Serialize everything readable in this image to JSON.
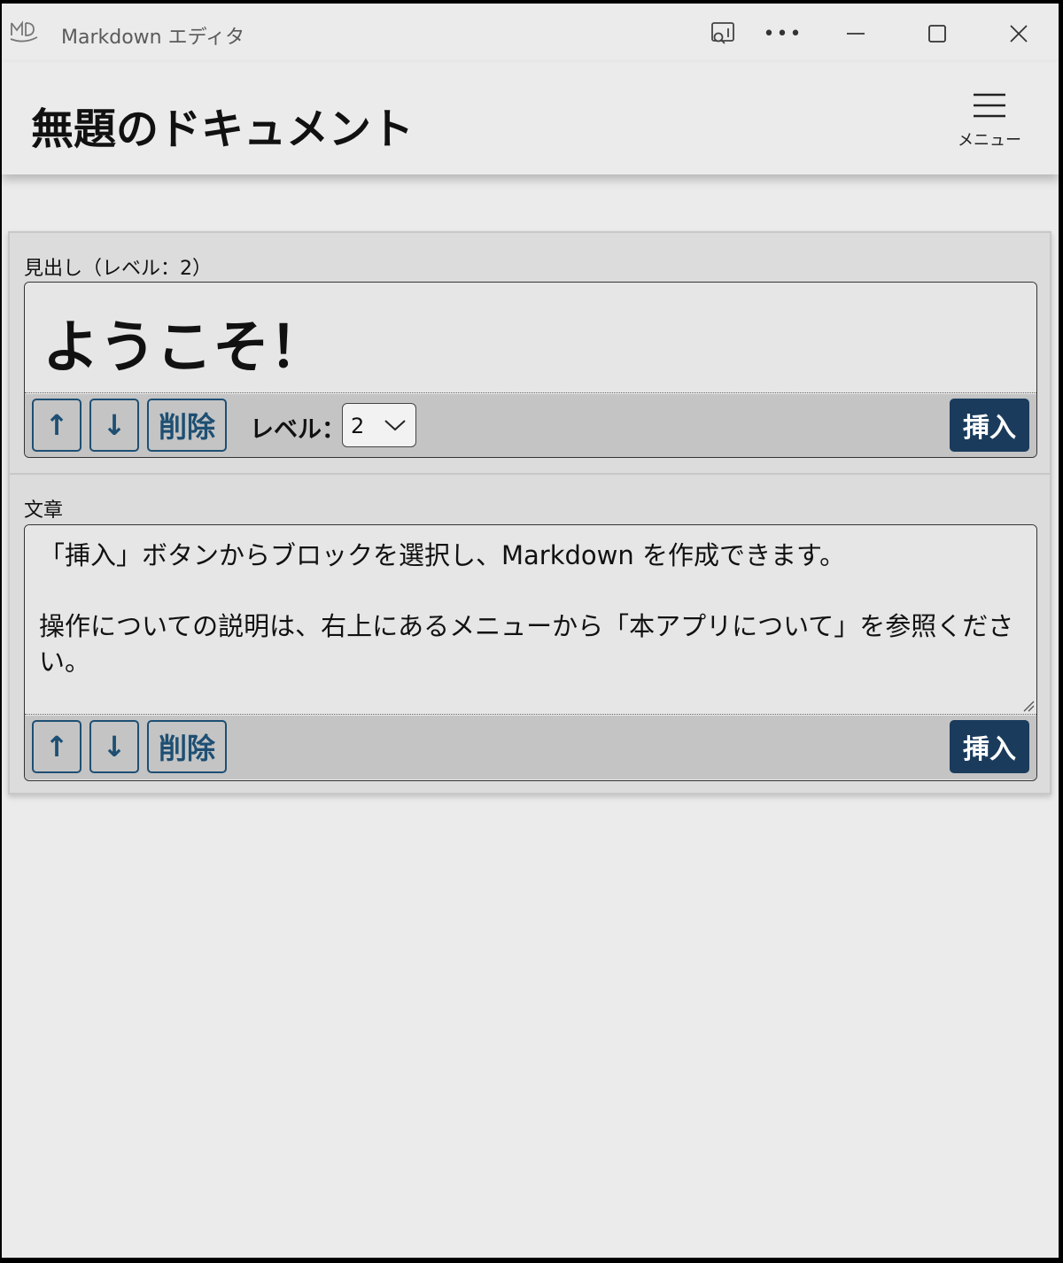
{
  "window": {
    "title": "Markdown エディタ",
    "more_glyph": "•••"
  },
  "header": {
    "doc_title": "無題のドキュメント",
    "menu_label": "メニュー"
  },
  "blocks": [
    {
      "label": "見出し（レベル：2）",
      "content": "ようこそ！",
      "buttons": {
        "up": "↑",
        "down": "↓",
        "delete": "削除",
        "insert": "挿入"
      },
      "level_label": "レベル：",
      "level_value": "2"
    },
    {
      "label": "文章",
      "content": "「挿入」ボタンからブロックを選択し、Markdown を作成できます。\n\n操作についての説明は、右上にあるメニューから「本アプリについて」を参照ください。",
      "buttons": {
        "up": "↑",
        "down": "↓",
        "delete": "削除",
        "insert": "挿入"
      }
    }
  ],
  "colors": {
    "accent": "#1e4f73",
    "insert_bg": "#1a3b5c",
    "background": "#ebebeb"
  }
}
